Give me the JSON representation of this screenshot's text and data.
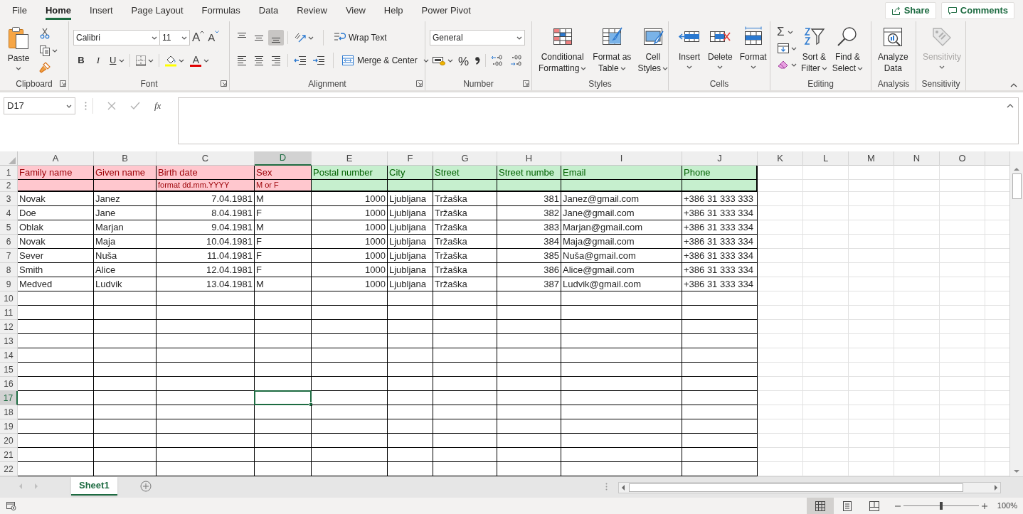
{
  "menu_tabs": [
    {
      "label": "File",
      "selected": false
    },
    {
      "label": "Home",
      "selected": true
    },
    {
      "label": "Insert",
      "selected": false
    },
    {
      "label": "Page Layout",
      "selected": false
    },
    {
      "label": "Formulas",
      "selected": false
    },
    {
      "label": "Data",
      "selected": false
    },
    {
      "label": "Review",
      "selected": false
    },
    {
      "label": "View",
      "selected": false
    },
    {
      "label": "Help",
      "selected": false
    },
    {
      "label": "Power Pivot",
      "selected": false
    }
  ],
  "share_button": "Share",
  "comments_button": "Comments",
  "ribbon": {
    "clipboard": {
      "label": "Clipboard",
      "paste": "Paste"
    },
    "font": {
      "label": "Font",
      "font_name": "Calibri",
      "font_size": "11",
      "grow": "A",
      "shrink": "A",
      "bold": "B",
      "italic": "I",
      "underline": "U",
      "font_color": "A"
    },
    "alignment": {
      "label": "Alignment",
      "wrap_text": "Wrap Text",
      "merge_center": "Merge & Center",
      "vertical_align": [
        {
          "selected": false
        },
        {
          "selected": false
        },
        {
          "selected": true
        }
      ]
    },
    "number": {
      "label": "Number",
      "format": "General",
      "percent": "%"
    },
    "styles": {
      "label": "Styles",
      "buttons": [
        {
          "lines": [
            "Conditional",
            "Formatting"
          ],
          "dropdown": true
        },
        {
          "lines": [
            "Format as",
            "Table"
          ],
          "dropdown": true
        },
        {
          "lines": [
            "Cell",
            "Styles"
          ],
          "dropdown": true
        }
      ]
    },
    "cells": {
      "label": "Cells",
      "buttons": [
        {
          "lines": [
            "Insert"
          ],
          "dropdown": true
        },
        {
          "lines": [
            "Delete"
          ],
          "dropdown": true
        },
        {
          "lines": [
            "Format"
          ],
          "dropdown": true
        }
      ]
    },
    "editing": {
      "label": "Editing",
      "sum": "Σ",
      "buttons": [
        {
          "lines": [
            "Sort &",
            "Filter"
          ],
          "dropdown": true
        },
        {
          "lines": [
            "Find &",
            "Select"
          ],
          "dropdown": true
        }
      ]
    },
    "analysis": {
      "label": "Analysis",
      "buttons": [
        {
          "lines": [
            "Analyze",
            "Data"
          ],
          "dropdown": false,
          "disabled": false
        }
      ]
    },
    "sensitivity": {
      "label": "Sensitivity",
      "buttons": [
        {
          "lines": [
            "Sensitivity"
          ],
          "dropdown": true,
          "disabled": true
        }
      ]
    }
  },
  "formula_bar": {
    "name_box": "D17",
    "function_label": "fx"
  },
  "table": {
    "columns": [
      {
        "letter": "A",
        "selected": false,
        "kind": "text",
        "color": "#ffc7ce"
      },
      {
        "letter": "B",
        "selected": false,
        "kind": "text",
        "color": "#ffc7ce"
      },
      {
        "letter": "C",
        "selected": false,
        "kind": "number",
        "color": "#ffc7ce"
      },
      {
        "letter": "D",
        "selected": true,
        "kind": "text",
        "color": "#ffc7ce"
      },
      {
        "letter": "E",
        "selected": false,
        "kind": "number",
        "color": "#c6efce"
      },
      {
        "letter": "F",
        "selected": false,
        "kind": "text",
        "color": "#c6efce"
      },
      {
        "letter": "G",
        "selected": false,
        "kind": "text",
        "color": "#c6efce"
      },
      {
        "letter": "H",
        "selected": false,
        "kind": "number",
        "color": "#c6efce"
      },
      {
        "letter": "I",
        "selected": false,
        "kind": "text",
        "color": "#c6efce"
      },
      {
        "letter": "J",
        "selected": false,
        "kind": "text",
        "color": "#c6efce"
      },
      {
        "letter": "K",
        "selected": false
      },
      {
        "letter": "L",
        "selected": false
      },
      {
        "letter": "M",
        "selected": false
      },
      {
        "letter": "N",
        "selected": false
      },
      {
        "letter": "O",
        "selected": false
      }
    ],
    "rows": [
      {
        "number": "1",
        "selected": false,
        "kind": "title",
        "cells": [
          "Family name",
          "Given name",
          "Birth date",
          "Sex",
          "Postal number",
          "City",
          "Street",
          "Street numbe",
          "Email",
          "Phone"
        ]
      },
      {
        "number": "2",
        "selected": false,
        "kind": "note",
        "cells": [
          null,
          null,
          "format dd.mm.YYYY",
          "M or F"
        ]
      },
      {
        "number": "3",
        "selected": false,
        "kind": "data",
        "cells": [
          "Novak",
          "Janez",
          "7.04.1981",
          "M",
          "1000",
          "Ljubljana",
          "Tržaška",
          "381",
          "Janez@gmail.com",
          "+386 31 333 333"
        ]
      },
      {
        "number": "4",
        "selected": false,
        "kind": "data",
        "cells": [
          "Doe",
          "Jane",
          "8.04.1981",
          "F",
          "1000",
          "Ljubljana",
          "Tržaška",
          "382",
          "Jane@gmail.com",
          "+386 31 333 334"
        ]
      },
      {
        "number": "5",
        "selected": false,
        "kind": "data",
        "cells": [
          "Oblak",
          "Marjan",
          "9.04.1981",
          "M",
          "1000",
          "Ljubljana",
          "Tržaška",
          "383",
          "Marjan@gmail.com",
          "+386 31 333 334"
        ]
      },
      {
        "number": "6",
        "selected": false,
        "kind": "data",
        "cells": [
          "Novak",
          "Maja",
          "10.04.1981",
          "F",
          "1000",
          "Ljubljana",
          "Tržaška",
          "384",
          "Maja@gmail.com",
          "+386 31 333 334"
        ]
      },
      {
        "number": "7",
        "selected": false,
        "kind": "data",
        "cells": [
          "Sever",
          "Nuša",
          "11.04.1981",
          "F",
          "1000",
          "Ljubljana",
          "Tržaška",
          "385",
          "Nuša@gmail.com",
          "+386 31 333 334"
        ]
      },
      {
        "number": "8",
        "selected": false,
        "kind": "data",
        "cells": [
          "Smith",
          "Alice",
          "12.04.1981",
          "F",
          "1000",
          "Ljubljana",
          "Tržaška",
          "386",
          "Alice@gmail.com",
          "+386 31 333 334"
        ]
      },
      {
        "number": "9",
        "selected": false,
        "kind": "data",
        "cells": [
          "Medved",
          "Ludvik",
          "13.04.1981",
          "M",
          "1000",
          "Ljubljana",
          "Tržaška",
          "387",
          "Ludvik@gmail.com",
          "+386 31 333 334"
        ]
      },
      {
        "number": "10",
        "selected": false,
        "kind": "data"
      },
      {
        "number": "11",
        "selected": false,
        "kind": "data"
      },
      {
        "number": "12",
        "selected": false,
        "kind": "data"
      },
      {
        "number": "13",
        "selected": false,
        "kind": "data"
      },
      {
        "number": "14",
        "selected": false,
        "kind": "data"
      },
      {
        "number": "15",
        "selected": false,
        "kind": "data"
      },
      {
        "number": "16",
        "selected": false,
        "kind": "data"
      },
      {
        "number": "17",
        "selected": true,
        "kind": "data"
      },
      {
        "number": "18",
        "selected": false,
        "kind": "data"
      },
      {
        "number": "19",
        "selected": false,
        "kind": "data"
      },
      {
        "number": "20",
        "selected": false,
        "kind": "data"
      },
      {
        "number": "21",
        "selected": false,
        "kind": "data"
      },
      {
        "number": "22",
        "selected": false,
        "kind": "data"
      }
    ]
  },
  "sheet_tabs": [
    {
      "label": "Sheet1",
      "selected": true
    }
  ],
  "status_bar": {
    "views": [
      {
        "selected": true
      },
      {
        "selected": false
      },
      {
        "selected": false
      }
    ],
    "zoom": {
      "level": 0.5,
      "reading": "100%"
    }
  }
}
